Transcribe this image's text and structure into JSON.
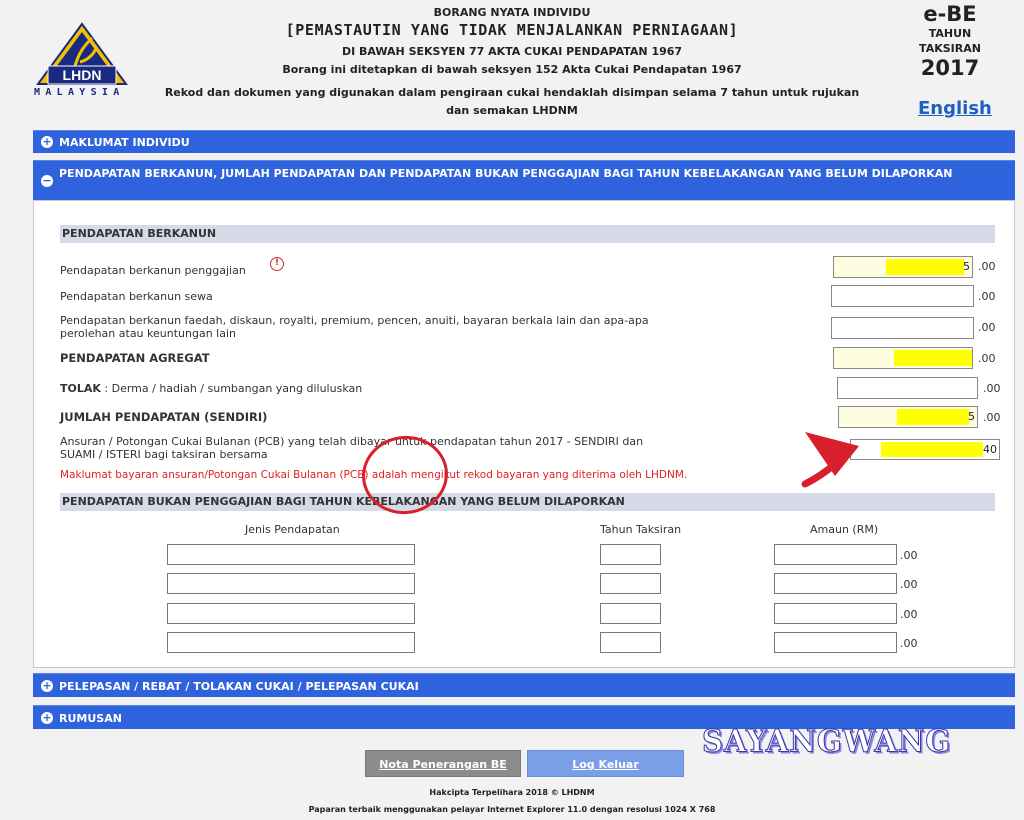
{
  "header": {
    "form_name": "BORANG NYATA INDIVIDU",
    "form_subtitle": "[PEMASTAUTIN YANG TIDAK MENJALANKAN PERNIAGAAN]",
    "act_line": "DI BAWAH SEKSYEN 77 AKTA CUKAI PENDAPATAN 1967",
    "prescribed_line": "Borang ini ditetapkan di bawah seksyen 152 Akta Cukai Pendapatan 1967",
    "records_line1": "Rekod dan dokumen yang digunakan dalam pengiraan cukai hendaklah disimpan selama 7 tahun untuk rujukan",
    "records_line2": "dan semakan LHDNM",
    "logo_text": "LHDN",
    "logo_country": "MALAYSIA",
    "form_code": "e-BE",
    "year_label_1": "TAHUN",
    "year_label_2": "TAKSIRAN",
    "year": "2017",
    "language_link": "English"
  },
  "sections": {
    "maklumat": "MAKLUMAT INDIVIDU",
    "pendapatan": "PENDAPATAN BERKANUN, JUMLAH PENDAPATAN DAN PENDAPATAN BUKAN PENGGAJIAN BAGI TAHUN KEBELAKANGAN YANG BELUM DILAPORKAN",
    "pelepasan": "PELEPASAN / REBAT / TOLAKAN CUKAI / PELEPASAN CUKAI",
    "rumusan": "RUMUSAN",
    "plus": "+",
    "minus": "−"
  },
  "berkanun": {
    "title": "PENDAPATAN BERKANUN",
    "gaji_label": "Pendapatan berkanun penggajian",
    "gaji_value": "5",
    "sewa_label": "Pendapatan berkanun sewa",
    "faedah_label_1": "Pendapatan berkanun faedah, diskaun, royalti, premium, pencen, anuiti, bayaran berkala lain dan apa-apa",
    "faedah_label_2": "perolehan atau keuntungan lain",
    "agregat_label": "PENDAPATAN AGREGAT",
    "tolak_label_bold": "TOLAK",
    "tolak_label_rest": " : Derma / hadiah / sumbangan yang diluluskan",
    "jumlah_label": "JUMLAH PENDAPATAN (SENDIRI)",
    "jumlah_value": "5",
    "pcb_label_1": "Ansuran / Potongan Cukai Bulanan (PCB) yang telah dibayar untuk pendapatan tahun 2017 - SENDIRI dan",
    "pcb_label_2": "SUAMI / ISTERI bagi taksiran bersama",
    "pcb_value": "40",
    "pcb_warning": "Maklumat bayaran ansuran/Potongan Cukai Bulanan (PCB) adalah mengikut rekod bayaran yang diterima oleh LHDNM.",
    "decimal": ".00",
    "info_icon": "!"
  },
  "bukan_penggajian": {
    "title": "PENDAPATAN BUKAN PENGGAJIAN BAGI TAHUN KEBELAKANGAN YANG BELUM DILAPORKAN",
    "col_jenis": "Jenis Pendapatan",
    "col_tahun": "Tahun Taksiran",
    "col_amaun": "Amaun (RM)",
    "decimal": ".00"
  },
  "footer": {
    "nota_button": "Nota Penerangan BE",
    "logout_button": "Log Keluar",
    "copyright": "Hakcipta Terpelihara 2018 © LHDNM",
    "browser_note": "Paparan terbaik menggunakan pelayar Internet Explorer 11.0 dengan resolusi 1024 X 768",
    "watermark": "SAYANGWANG"
  }
}
